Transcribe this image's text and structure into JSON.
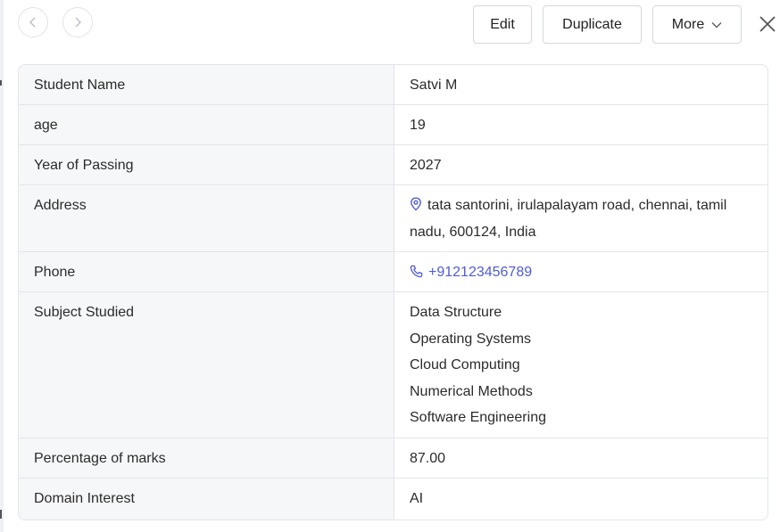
{
  "toolbar": {
    "edit_label": "Edit",
    "duplicate_label": "Duplicate",
    "more_label": "More"
  },
  "record": {
    "student_name": {
      "label": "Student Name",
      "value": "Satvi M"
    },
    "age": {
      "label": "age",
      "value": "19"
    },
    "year_of_passing": {
      "label": "Year of Passing",
      "value": "2027"
    },
    "address": {
      "label": "Address",
      "value": "tata santorini, irulapalayam road, chennai, tamil nadu, 600124, India",
      "icon": "location-pin-icon"
    },
    "phone": {
      "label": "Phone",
      "value": "+912123456789",
      "icon": "phone-icon"
    },
    "subjects": {
      "label": "Subject Studied",
      "values": [
        "Data Structure",
        "Operating Systems",
        "Cloud Computing",
        "Numerical Methods",
        "Software Engineering"
      ]
    },
    "percentage": {
      "label": "Percentage of marks",
      "value": "87.00"
    },
    "domain_interest": {
      "label": "Domain Interest",
      "value": "AI"
    }
  },
  "colors": {
    "link": "#4f5bd5",
    "label_bg": "#f6f7f9",
    "border": "#e3e5ea"
  }
}
